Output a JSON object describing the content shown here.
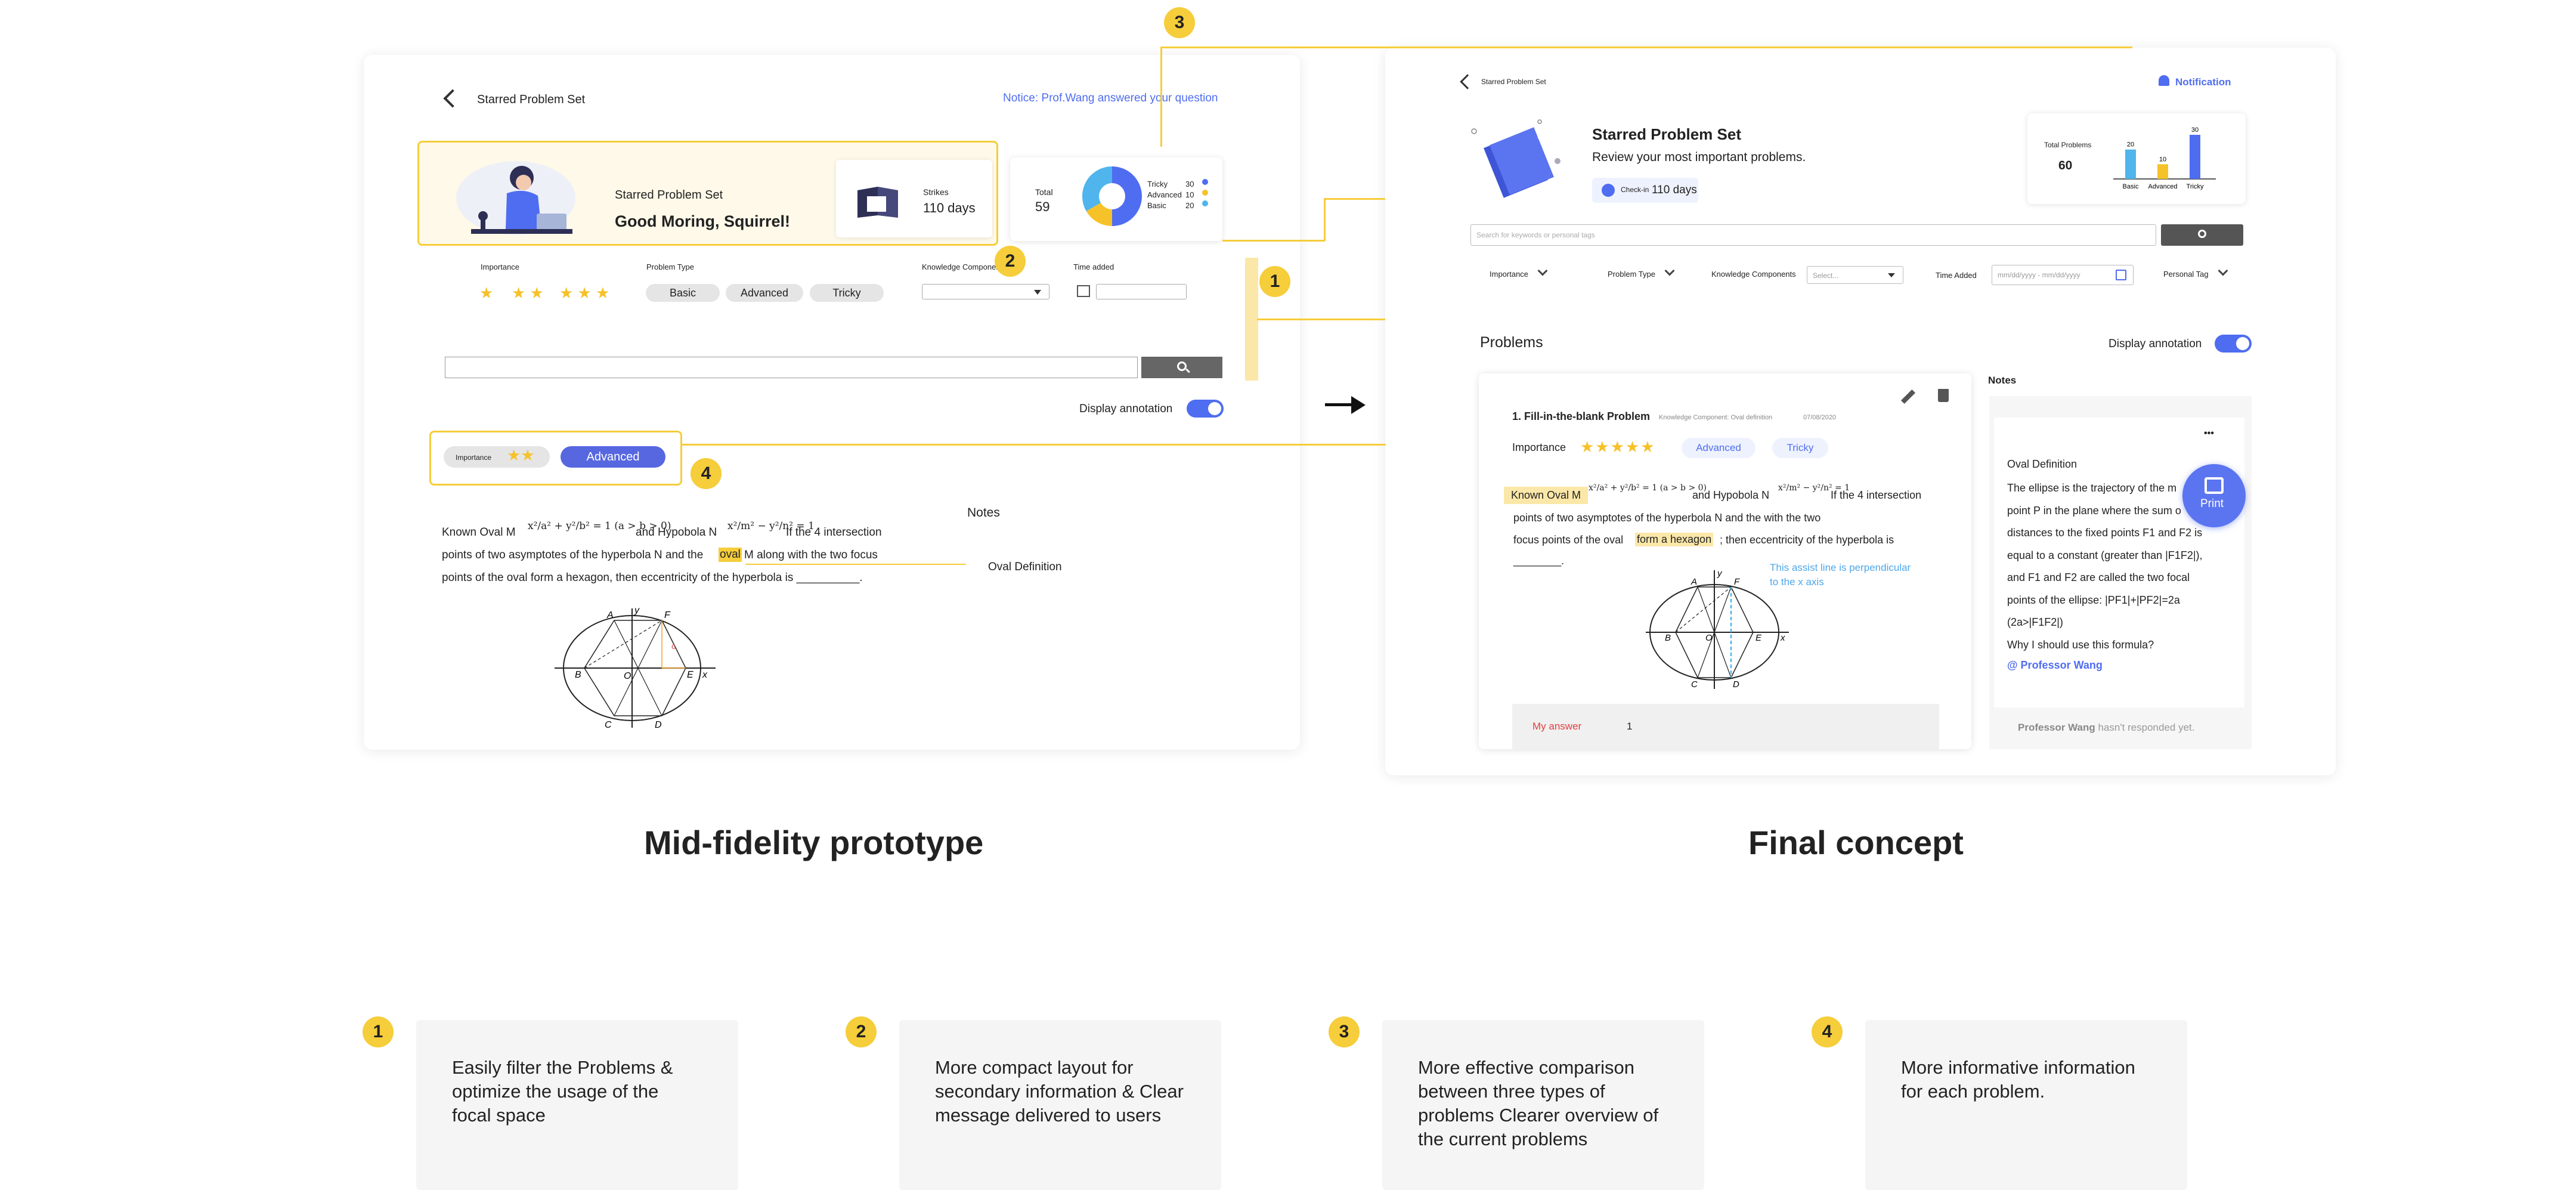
{
  "mid": {
    "title": "Starred Problem Set",
    "notice": "Notice: Prof.Wang answered your question",
    "banner": {
      "subtitle": "Starred Problem Set",
      "greeting": "Good Moring, Squirrel!"
    },
    "strikes": {
      "label": "Strikes",
      "value": "110 days"
    },
    "chart": {
      "total_label": "Total",
      "total_value": "59"
    },
    "filters": {
      "importance": "Importance",
      "problem_type": "Problem Type",
      "knowledge": "Knowledge Components",
      "time_added": "Time added",
      "stars": [
        "★",
        "★ ★",
        "★ ★ ★"
      ],
      "types": [
        "Basic",
        "Advanced",
        "Tricky"
      ]
    },
    "display_annotation": "Display annotation",
    "tag_importance": "Importance",
    "tag_stars": "★★",
    "tag_advanced": "Advanced",
    "notes_title": "Notes",
    "problem": {
      "p1": "Known Oval M",
      "p2": "and Hypobola N",
      "p3": "If the 4 intersection",
      "line2a": "points of two asymptotes of the hyperbola N and the",
      "line2hl": "oval",
      "line2b": "M along with the two focus",
      "line3": "points of the oval form a hexagon, then eccentricity of the hyperbola is __________.",
      "formula1": "x²/a² + y²/b² = 1 (a > b > 0)",
      "formula2": "x²/m² − y²/n² = 1"
    },
    "oval_definition": "Oval Definition"
  },
  "final": {
    "title": "Starred Problem Set",
    "notification": "Notification",
    "heading": "Starred Problem Set",
    "subheading": "Review your most important problems.",
    "checkin_label": "Check-in",
    "checkin_value": "110 days",
    "total_label": "Total Problems",
    "total_value": "60",
    "search_placeholder": "Search for keywords or personal tags",
    "filters": {
      "importance": "Importance",
      "problem_type": "Problem Type",
      "knowledge": "Knowledge Components",
      "knowledge_select": "Select...",
      "time_added": "Time Added",
      "date_placeholder": "mm/dd/yyyy - mm/dd/yyyy",
      "personal_tag": "Personal Tag"
    },
    "problems_title": "Problems",
    "display_annotation": "Display annotation",
    "problem": {
      "title": "1. Fill-in-the-blank Problem",
      "knowledge": "Knowledge Component: Oval definition",
      "date": "07/08/2020",
      "importance": "Importance",
      "stars": "★★★★★",
      "tag1": "Advanced",
      "tag2": "Tricky",
      "hl1": "Known Oval M",
      "formula1": "x²/a² + y²/b² = 1 (a > b > 0)",
      "p2": "and Hypobola N",
      "formula2": "x²/m² − y²/n² = 1",
      "p3": "If the 4 intersection",
      "line2": "points of two asymptotes of the hyperbola N and the with the two",
      "line3a": "focus points of the oval",
      "line3hl": "form a hexagon",
      "line3b": "; then eccentricity of the hyperbola is",
      "blank": "________.",
      "assist": "This assist line is perpendicular to the x axis",
      "my_answer_label": "My answer",
      "my_answer_value": "1"
    },
    "notes": {
      "title": "Notes",
      "menu": "•••",
      "head": "Oval Definition",
      "lines": [
        "The ellipse is the trajectory of the m",
        "point P in the plane where the sum o",
        "distances to the fixed points F1 and F2 is",
        "equal to a constant (greater than |F1F2|),",
        "and F1 and F2 are called the two focal",
        "points of the ellipse: |PF1|+|PF2|=2a",
        "(2a>|F1F2|)",
        "Why I should use this formula?"
      ],
      "mention": "@ Professor Wang",
      "reply_name": "Professor Wang",
      "reply_text": "hasn't responded yet.",
      "print": "Print"
    }
  },
  "chart_data": [
    {
      "type": "pie",
      "labels": [
        "Tricky",
        "Advanced",
        "Basic"
      ],
      "values": [
        30,
        10,
        20
      ],
      "colors": [
        "#4f6df0",
        "#f6c22a",
        "#4fb5ec"
      ]
    },
    {
      "type": "bar",
      "categories": [
        "Basic",
        "Advanced",
        "Tricky"
      ],
      "values": [
        20,
        10,
        30
      ],
      "colors": [
        "#4fb5ec",
        "#f6c22a",
        "#4f6df0"
      ]
    }
  ],
  "captions": {
    "mid": "Mid-fidelity prototype",
    "final": "Final concept"
  },
  "annotations": [
    {
      "num": "1",
      "text": "Easily filter the Problems & optimize the usage of the focal space"
    },
    {
      "num": "2",
      "text": "More compact layout for secondary information & Clear message delivered to users"
    },
    {
      "num": "3",
      "text": "More effective comparison between three types of problems Clearer overview of the current problems"
    },
    {
      "num": "4",
      "text": "More informative information for each problem."
    }
  ],
  "colors": {
    "accent": "#4f6df0",
    "highlight": "#f6cd3a",
    "basic": "#4fb5ec",
    "advanced": "#f6c22a",
    "tricky": "#4f6df0"
  }
}
